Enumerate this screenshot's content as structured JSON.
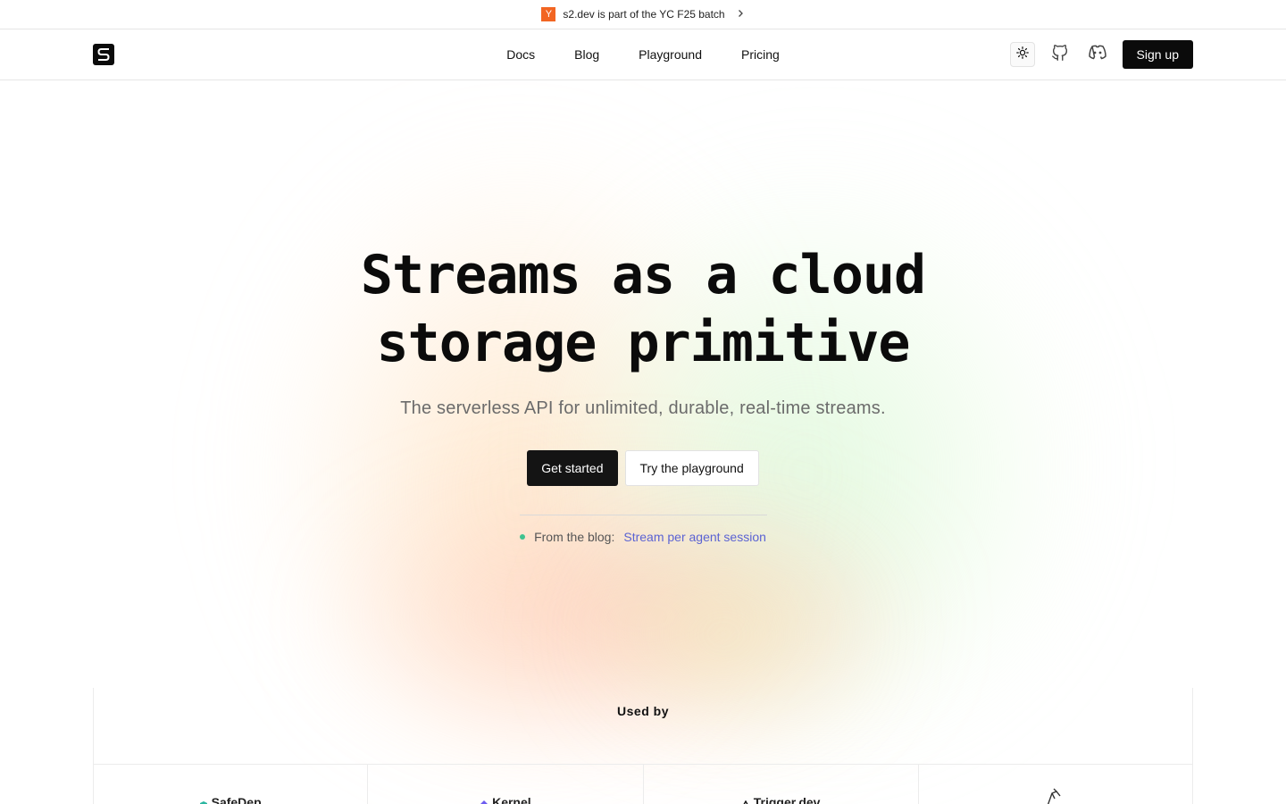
{
  "announcement": {
    "badge": "Y",
    "text": "s2.dev is part of the YC F25 batch",
    "badge_color": "#f26522"
  },
  "nav": {
    "links": [
      "Docs",
      "Blog",
      "Playground",
      "Pricing"
    ],
    "signup_label": "Sign up",
    "icons": [
      "sun-icon",
      "github-icon",
      "discord-icon"
    ]
  },
  "hero": {
    "title_line1": "Streams as a cloud",
    "title_line2": "storage primitive",
    "subtitle": "The serverless API for unlimited, durable, real-time streams.",
    "primary_cta": "Get started",
    "secondary_cta": "Try the playground",
    "blog_prefix": "From the blog:",
    "blog_link": "Stream per agent session"
  },
  "used_by": {
    "label": "Used by",
    "logos": [
      "SafeDep",
      "Kernel",
      "Trigger.dev",
      ""
    ]
  },
  "colors": {
    "accent_link": "#5b63d3",
    "dot": "#3ec28f",
    "button_dark": "#141414"
  }
}
